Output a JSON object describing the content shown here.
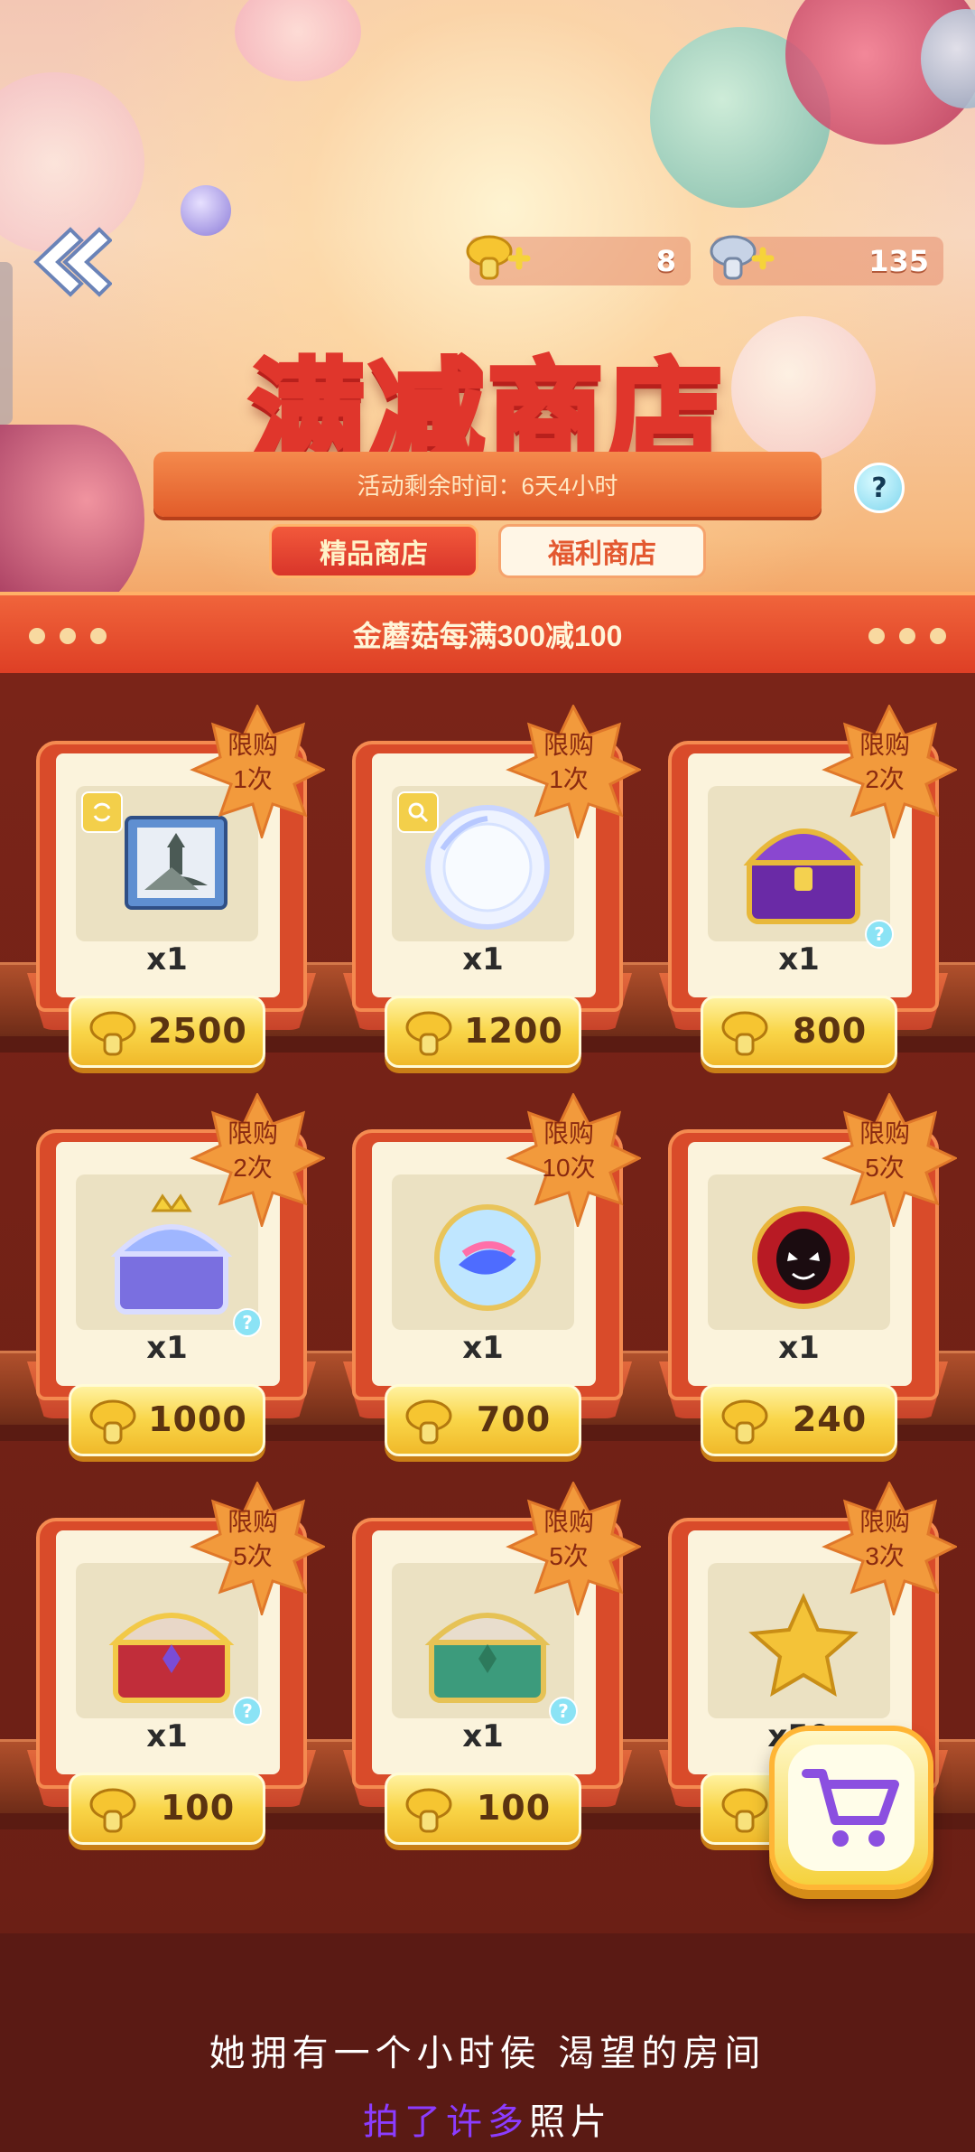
{
  "header": {
    "currency_gold": "8",
    "currency_silver": "135",
    "title": "满减商店",
    "remaining_time": "活动剩余时间：6天4小时",
    "help_label": "?",
    "tabs": [
      {
        "label": "精品商店",
        "active": true
      },
      {
        "label": "福利商店",
        "active": false
      }
    ],
    "promo": "金蘑菇每满300减100"
  },
  "items": [
    {
      "limit_line1": "限购",
      "limit_line2": "1次",
      "qty": "x1",
      "price": "2500",
      "icon": "landscape-painting-icon",
      "has_info": false,
      "corner_icon": "swap-icon"
    },
    {
      "limit_line1": "限购",
      "limit_line2": "1次",
      "qty": "x1",
      "price": "1200",
      "icon": "crystal-bubble-icon",
      "has_info": false,
      "corner_icon": "magnifier-icon"
    },
    {
      "limit_line1": "限购",
      "limit_line2": "2次",
      "qty": "x1",
      "price": "800",
      "icon": "purple-gold-chest-icon",
      "has_info": true
    },
    {
      "limit_line1": "限购",
      "limit_line2": "2次",
      "qty": "x1",
      "price": "1000",
      "icon": "crown-chest-icon",
      "has_info": true
    },
    {
      "limit_line1": "限购",
      "limit_line2": "10次",
      "qty": "x1",
      "price": "700",
      "icon": "rainbow-orb-icon",
      "has_info": false
    },
    {
      "limit_line1": "限购",
      "limit_line2": "5次",
      "qty": "x1",
      "price": "240",
      "icon": "venom-badge-icon",
      "has_info": false
    },
    {
      "limit_line1": "限购",
      "limit_line2": "5次",
      "qty": "x1",
      "price": "100",
      "icon": "red-chest-icon",
      "has_info": true
    },
    {
      "limit_line1": "限购",
      "limit_line2": "5次",
      "qty": "x1",
      "price": "100",
      "icon": "green-chest-icon",
      "has_info": true
    },
    {
      "limit_line1": "限购",
      "limit_line2": "3次",
      "qty": "x50",
      "price": "",
      "icon": "gold-star-icon",
      "has_info": false
    }
  ],
  "subtitle": {
    "line1": "她拥有一个小时侯 渴望的房间",
    "line2_highlight": "拍了许多",
    "line2_normal": "照片"
  },
  "colors": {
    "accent_red": "#d9352a",
    "gold": "#f9d548",
    "shelf": "#8a3a1f",
    "highlight_purple": "#8b3cff"
  }
}
